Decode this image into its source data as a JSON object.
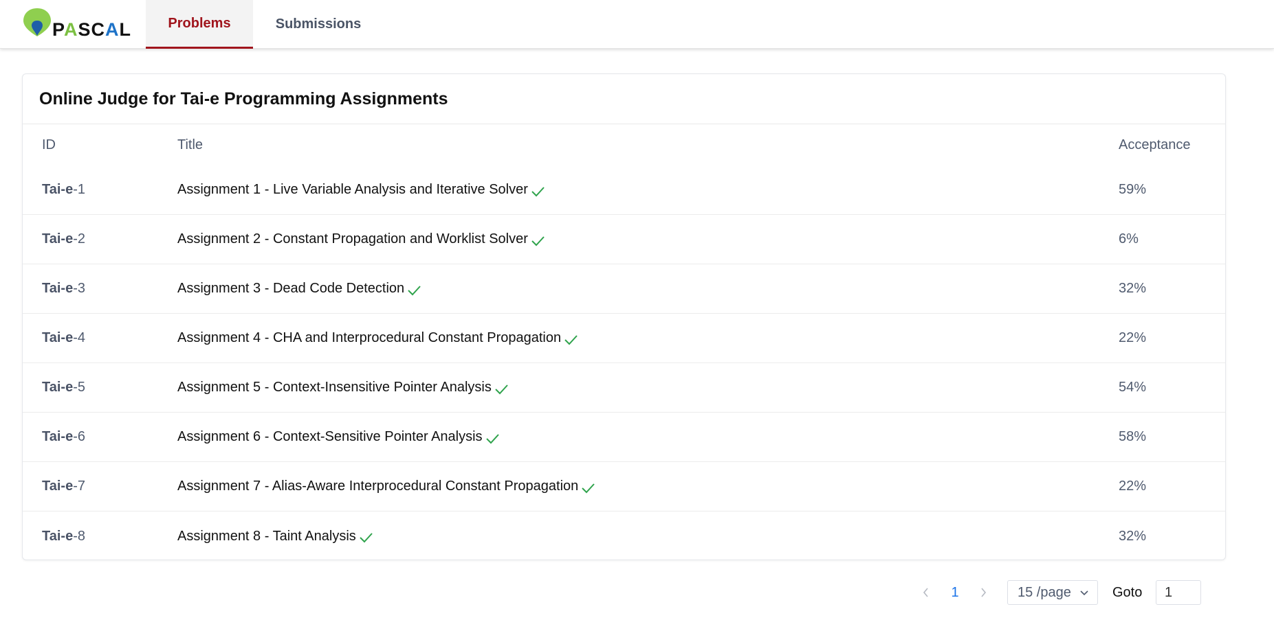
{
  "header": {
    "logo_text": [
      "P",
      "A",
      "S",
      "C",
      "A",
      "L"
    ],
    "logo_colors": [
      "#111111",
      "#7cc043",
      "#111111",
      "#111111",
      "#1e73c8",
      "#111111"
    ],
    "tabs": [
      {
        "label": "Problems",
        "active": true
      },
      {
        "label": "Submissions",
        "active": false
      }
    ]
  },
  "main": {
    "title": "Online Judge for Tai-e Programming Assignments",
    "columns": {
      "id": "ID",
      "title": "Title",
      "acceptance": "Acceptance"
    },
    "problems": [
      {
        "id_prefix": "Tai-e",
        "id_suffix": "-1",
        "title": "Assignment 1 - Live Variable Analysis and Iterative Solver",
        "solved": true,
        "acceptance": "59%"
      },
      {
        "id_prefix": "Tai-e",
        "id_suffix": "-2",
        "title": "Assignment 2 - Constant Propagation and Worklist Solver",
        "solved": true,
        "acceptance": "6%"
      },
      {
        "id_prefix": "Tai-e",
        "id_suffix": "-3",
        "title": "Assignment 3 - Dead Code Detection",
        "solved": true,
        "acceptance": "32%"
      },
      {
        "id_prefix": "Tai-e",
        "id_suffix": "-4",
        "title": "Assignment 4 - CHA and Interprocedural Constant Propagation",
        "solved": true,
        "acceptance": "22%"
      },
      {
        "id_prefix": "Tai-e",
        "id_suffix": "-5",
        "title": "Assignment 5 - Context-Insensitive Pointer Analysis",
        "solved": true,
        "acceptance": "54%"
      },
      {
        "id_prefix": "Tai-e",
        "id_suffix": "-6",
        "title": "Assignment 6 - Context-Sensitive Pointer Analysis",
        "solved": true,
        "acceptance": "58%"
      },
      {
        "id_prefix": "Tai-e",
        "id_suffix": "-7",
        "title": "Assignment 7 - Alias-Aware Interprocedural Constant Propagation",
        "solved": true,
        "acceptance": "22%"
      },
      {
        "id_prefix": "Tai-e",
        "id_suffix": "-8",
        "title": "Assignment 8 - Taint Analysis",
        "solved": true,
        "acceptance": "32%"
      }
    ]
  },
  "pagination": {
    "current_page": "1",
    "page_size": "15 /page",
    "goto_label": "Goto",
    "goto_value": "1"
  },
  "colors": {
    "brand": "#a0141c",
    "check": "#2fa34c",
    "link": "#1b73e8"
  },
  "icons": {
    "logo": "location-pin-logo-icon",
    "solved": "check-icon",
    "prev": "chevron-left-icon",
    "next": "chevron-right-icon",
    "size_dropdown": "chevron-down-icon"
  }
}
